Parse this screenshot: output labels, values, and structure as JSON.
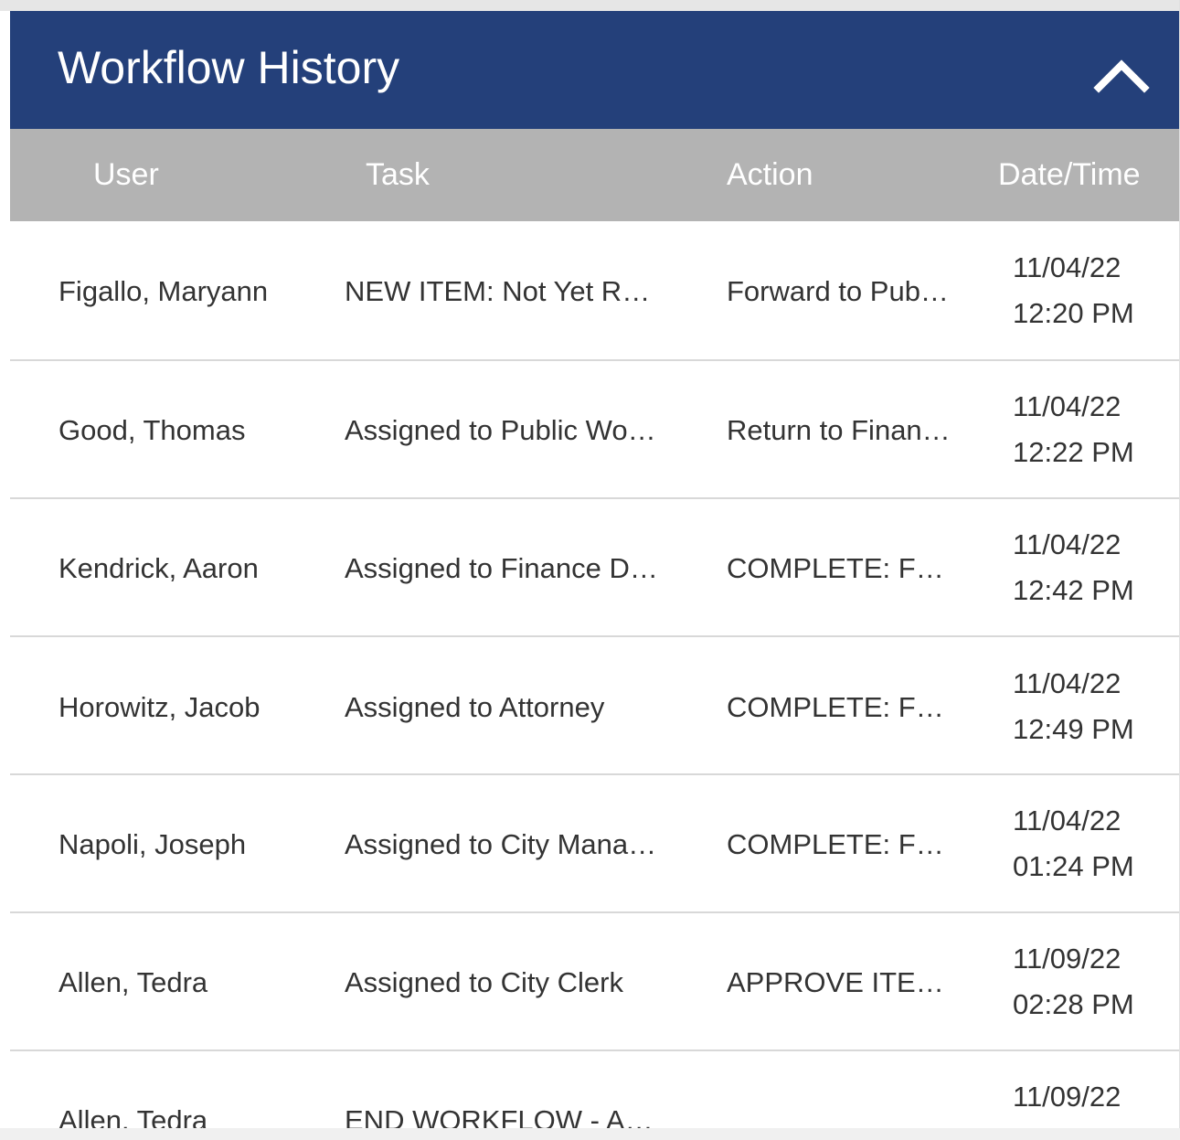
{
  "panel": {
    "title": "Workflow History",
    "collapse_icon": "chevron-up-icon",
    "header_color": "#24407a",
    "column_header_color": "#b3b3b3"
  },
  "columns": {
    "user": "User",
    "task": "Task",
    "action": "Action",
    "datetime": "Date/Time"
  },
  "rows": [
    {
      "user": "Figallo, Maryann",
      "task": "NEW ITEM: Not Yet R…",
      "action": "Forward to Pub…",
      "date": "11/04/22",
      "time": "12:20 PM"
    },
    {
      "user": "Good, Thomas",
      "task": "Assigned to Public Wo…",
      "action": "Return to Finan…",
      "date": "11/04/22",
      "time": "12:22 PM"
    },
    {
      "user": "Kendrick, Aaron",
      "task": "Assigned to Finance D…",
      "action": "COMPLETE: F…",
      "date": "11/04/22",
      "time": "12:42 PM"
    },
    {
      "user": "Horowitz, Jacob",
      "task": "Assigned to Attorney",
      "action": "COMPLETE: F…",
      "date": "11/04/22",
      "time": "12:49 PM"
    },
    {
      "user": "Napoli, Joseph",
      "task": "Assigned to City Mana…",
      "action": "COMPLETE: F…",
      "date": "11/04/22",
      "time": "01:24 PM"
    },
    {
      "user": "Allen, Tedra",
      "task": "Assigned to City Clerk",
      "action": "APPROVE ITE…",
      "date": "11/09/22",
      "time": "02:28 PM"
    },
    {
      "user": "Allen, Tedra",
      "task": "END WORKFLOW - A…",
      "action": "",
      "date": "11/09/22",
      "time": ""
    }
  ]
}
